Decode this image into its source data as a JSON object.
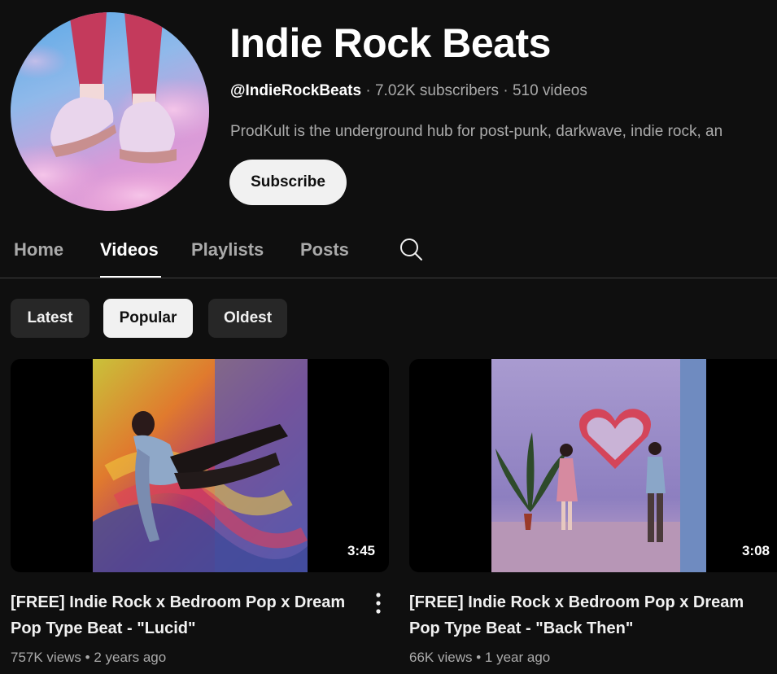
{
  "channel": {
    "title": "Indie Rock Beats",
    "handle": "@IndieRockBeats",
    "subscribers": "7.02K subscribers",
    "videos": "510 videos",
    "separator": "·",
    "description": "ProdKult is the underground hub for post-punk, darkwave, indie rock, an",
    "subscribe_label": "Subscribe"
  },
  "tabs": [
    {
      "label": "Home"
    },
    {
      "label": "Videos"
    },
    {
      "label": "Playlists"
    },
    {
      "label": "Posts"
    }
  ],
  "active_tab": "Videos",
  "search_icon": "search-icon",
  "chips": [
    {
      "label": "Latest"
    },
    {
      "label": "Popular"
    },
    {
      "label": "Oldest"
    }
  ],
  "active_chip": "Popular",
  "videos": [
    {
      "title": "[FREE] Indie Rock x Bedroom Pop x Dream Pop Type Beat - \"Lucid\"",
      "duration": "3:45",
      "views": "757K views",
      "age": "2 years ago"
    },
    {
      "title": "[FREE] Indie Rock x Bedroom Pop x Dream Pop Type Beat - \"Back Then\"",
      "duration": "3:08",
      "views": "66K views",
      "age": "1 year ago"
    }
  ],
  "meta_separator": "•",
  "colors": {
    "background": "#0f0f0f",
    "text_primary": "#f1f1f1",
    "text_secondary": "#aaaaaa",
    "chip_bg": "#272727"
  }
}
